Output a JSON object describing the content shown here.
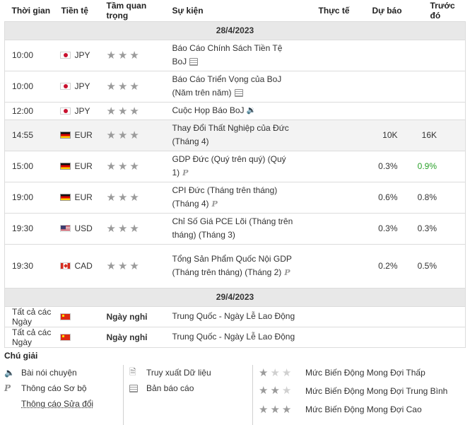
{
  "headers": {
    "time": "Thời gian",
    "currency": "Tiền tệ",
    "importance": "Tầm quan trọng",
    "event": "Sự kiện",
    "actual": "Thực tế",
    "forecast": "Dự báo",
    "previous": "Trước đó"
  },
  "days": [
    {
      "date": "28/4/2023",
      "events": [
        {
          "time": "10:00",
          "currency": "JPY",
          "flag": "jp",
          "stars": 3,
          "event": "Báo Cáo Chính Sách Tiền Tệ BoJ",
          "icon": "report-icon",
          "actual": "",
          "forecast": "",
          "previous": ""
        },
        {
          "time": "10:00",
          "currency": "JPY",
          "flag": "jp",
          "stars": 3,
          "event": "Báo Cáo Triển Vọng của BoJ (Năm trên năm)",
          "icon": "report-icon",
          "actual": "",
          "forecast": "",
          "previous": ""
        },
        {
          "time": "12:00",
          "currency": "JPY",
          "flag": "jp",
          "stars": 3,
          "event": "Cuộc Họp Báo BoJ",
          "icon": "speech-icon",
          "actual": "",
          "forecast": "",
          "previous": ""
        },
        {
          "time": "14:55",
          "currency": "EUR",
          "flag": "de",
          "stars": 3,
          "event": "Thay Đổi Thất Nghiệp của Đức (Tháng 4)",
          "icon": "",
          "actual": "",
          "forecast": "10K",
          "previous": "16K"
        },
        {
          "time": "15:00",
          "currency": "EUR",
          "flag": "de",
          "stars": 3,
          "event": "GDP Đức (Quý trên quý) (Quý 1)",
          "icon": "preliminary-icon",
          "actual": "",
          "forecast": "0.3%",
          "previous": "0.9%"
        },
        {
          "time": "19:00",
          "currency": "EUR",
          "flag": "de",
          "stars": 3,
          "event": "CPI Đức (Tháng trên tháng) (Tháng 4)",
          "icon": "preliminary-icon",
          "actual": "",
          "forecast": "0.6%",
          "previous": "0.8%"
        },
        {
          "time": "19:30",
          "currency": "USD",
          "flag": "us",
          "stars": 3,
          "event": "Chỉ Số Giá PCE Lõi (Tháng trên tháng) (Tháng 3)",
          "icon": "",
          "actual": "",
          "forecast": "0.3%",
          "previous": "0.3%"
        },
        {
          "time": "19:30",
          "currency": "CAD",
          "flag": "ca",
          "stars": 3,
          "event": "Tổng Sản Phẩm Quốc Nội GDP (Tháng trên tháng) (Tháng 2)",
          "icon": "preliminary-icon",
          "actual": "",
          "forecast": "0.2%",
          "previous": "0.5%"
        }
      ]
    },
    {
      "date": "29/4/2023",
      "holidays": [
        {
          "time": "Tất cả các Ngày",
          "flag": "cn",
          "label": "Ngày nghỉ",
          "event": "Trung Quốc - Ngày Lễ Lao Động"
        },
        {
          "time": "Tất cả các Ngày",
          "flag": "cn",
          "label": "Ngày nghỉ",
          "event": "Trung Quốc - Ngày Lễ Lao Động"
        }
      ]
    }
  ],
  "colors": {
    "positive": "#2aa12a",
    "date_bar": "#e8e8e8"
  },
  "legend": {
    "title": "Chú giải",
    "speech": "Bài nói chuyện",
    "preliminary": "Thông cáo Sơ bộ",
    "revised": "Thông cáo Sửa đổi",
    "retrieve": "Truy xuất Dữ liệu",
    "report": "Bản báo cáo",
    "low": "Mức Biến Động Mong Đợi Thấp",
    "medium": "Mức Biến Động Mong Đợi Trung Bình",
    "high": "Mức Biến Động Mong Đợi Cao"
  }
}
